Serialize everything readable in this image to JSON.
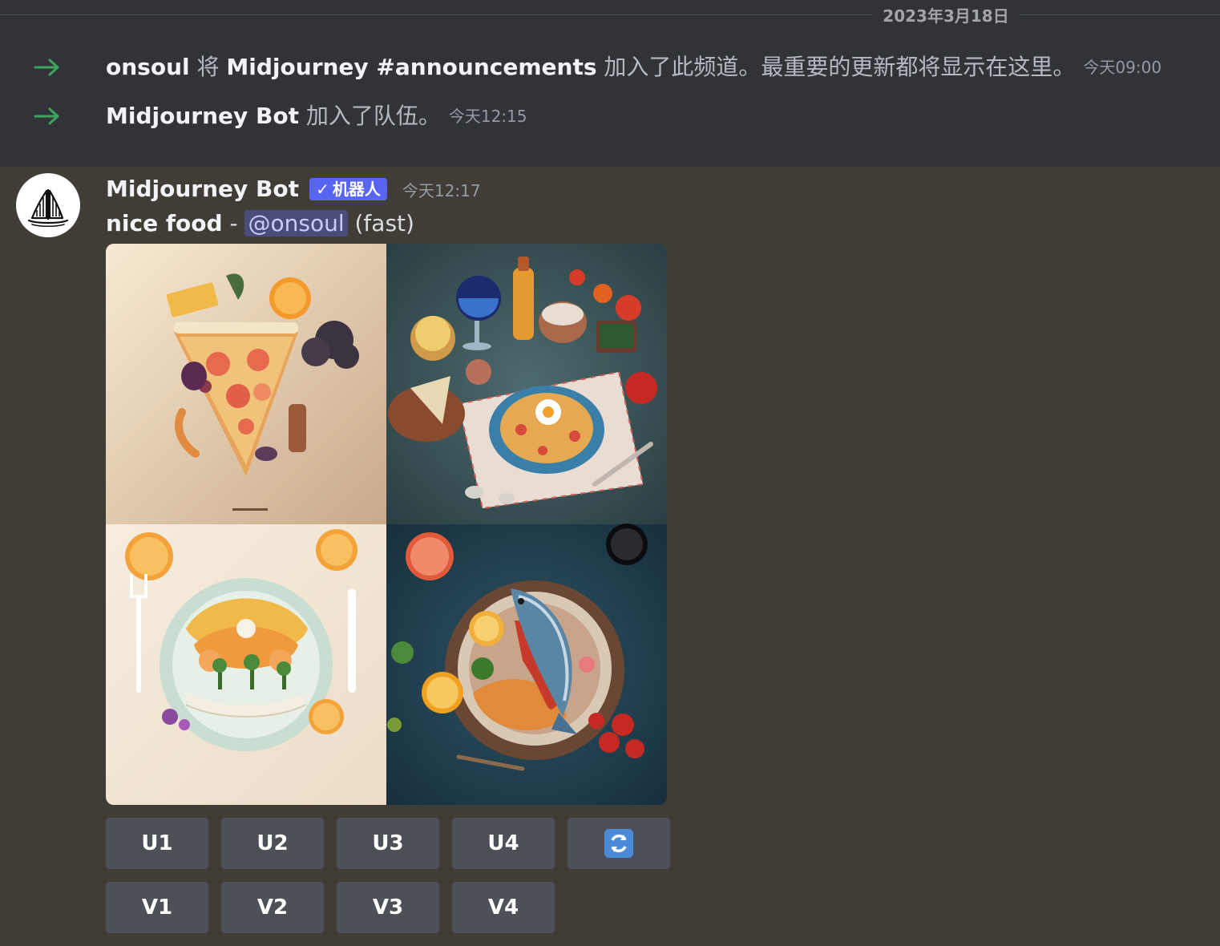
{
  "date_divider": "2023年3月18日",
  "system_messages": [
    {
      "user": "onsoul",
      "text_before": " 将 ",
      "channel": "Midjourney #announcements",
      "text_after": " 加入了此频道。最重要的更新都将显示在这里。",
      "time": "今天09:00",
      "icon": "join-arrow-icon"
    },
    {
      "user": "Midjourney Bot",
      "text_after": " 加入了队伍。",
      "time": "今天12:15",
      "icon": "join-arrow-icon"
    }
  ],
  "message": {
    "author": "Midjourney Bot",
    "bot_tag": {
      "check": "✓",
      "label": "机器人"
    },
    "time": "今天12:17",
    "prompt": "nice food",
    "separator": " - ",
    "mention": "@onsoul",
    "speed": " (fast)",
    "avatar_icon": "sailboat-logo-icon",
    "images": [
      {
        "name": "pizza-slice-image"
      },
      {
        "name": "table-spread-image"
      },
      {
        "name": "citrus-plate-image"
      },
      {
        "name": "fish-dish-image"
      }
    ]
  },
  "buttons": {
    "upscale": [
      "U1",
      "U2",
      "U3",
      "U4"
    ],
    "variation": [
      "V1",
      "V2",
      "V3",
      "V4"
    ],
    "reroll_icon": "refresh-icon"
  },
  "colors": {
    "accent_bot_tag": "#5865f2",
    "join_arrow": "#3ba55c",
    "button_bg": "#4e5058",
    "reroll_bg": "#4a8ad6"
  }
}
